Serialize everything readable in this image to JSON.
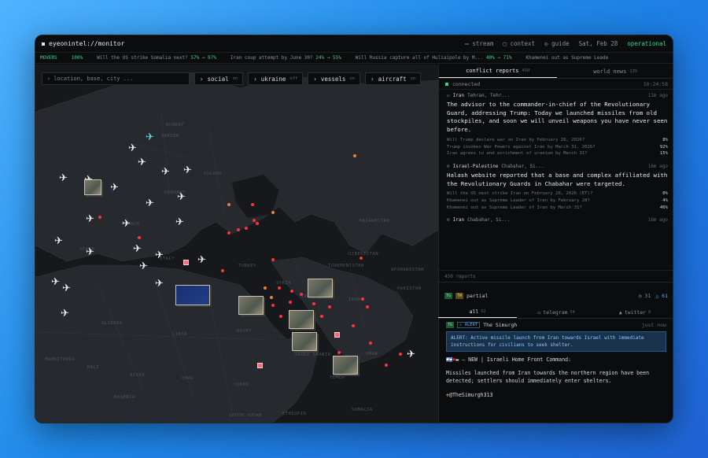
{
  "app": {
    "title": "eyeonintel://monitor"
  },
  "topbar": {
    "stream": "stream",
    "context": "context",
    "guide": "guide",
    "date": "Sat, Feb 28",
    "status": "operational"
  },
  "ticker": {
    "label": "MOVERS",
    "items": [
      {
        "pct": "100%",
        "text": "Will the US strike Somalia next?",
        "move": "57% → 97%"
      },
      {
        "text": "Iran coup attempt by June 30?",
        "move": "24% → 55%"
      },
      {
        "text": "Will Russia capture all of Huliaipole by M...",
        "move": "40% → 71%"
      },
      {
        "text": "Khamenei out as Supreme Leade"
      }
    ]
  },
  "map": {
    "search_placeholder": "location, base, city ...",
    "toggles": [
      {
        "label": "social",
        "state": "on"
      },
      {
        "label": "ukraine",
        "state": "off"
      },
      {
        "label": "vessels",
        "state": "on"
      },
      {
        "label": "aircraft",
        "state": "on"
      }
    ],
    "labels": [
      "NORWAY",
      "SWEDEN",
      "POLAND",
      "KAZAKHSTAN",
      "UZBEKISTAN",
      "TURKMENISTAN",
      "TURKEY",
      "AFGHANISTAN",
      "PAKISTAN",
      "IRAN",
      "IRAQ",
      "SYRIA",
      "ALGERIA",
      "LIBYA",
      "EGYPT",
      "MALI",
      "NIGER",
      "CHAD",
      "SUDAN",
      "SOUTH SUDAN",
      "SAUDI ARABIA",
      "ETHIOPIA",
      "NIGERIA",
      "OMAN",
      "YEMEN",
      "SOMALIA",
      "MAURITANIA",
      "FRANCE",
      "SPAIN",
      "GERMANY",
      "ITALY"
    ]
  },
  "panel": {
    "tabs": [
      {
        "label": "conflict reports",
        "count": "450"
      },
      {
        "label": "world news",
        "count": "135"
      }
    ],
    "connection": {
      "status": "connected",
      "time": "10:24:58"
    },
    "reports": [
      {
        "region": "Iran",
        "location": "Tehran, Tehr...",
        "ago": "11m ago",
        "body": "The advisor to the commander-in-chief of the Revolutionary Guard, addressing Trump: Today we launched missiles from old stockpiles, and soon we will unveil weapons you have never seen before.",
        "markets": [
          {
            "q": "Will Trump declare war on Iran by February 28, 2026?",
            "p": "8%"
          },
          {
            "q": "Trump invokes War Powers against Iran by March 31, 2026?",
            "p": "92%"
          },
          {
            "q": "Iran agrees to end enrichment of uranium by March 31?",
            "p": "15%"
          }
        ]
      },
      {
        "region": "Israel-Palestine",
        "location": "Chabahar, Si...",
        "ago": "16m ago",
        "body": "Halash website reported that a base and complex affiliated with the Revolutionary Guards in Chabahar were targeted.",
        "markets": [
          {
            "q": "Will the US next strike Iran on February 28, 2026 (ET)?",
            "p": "0%"
          },
          {
            "q": "Khamenei out as Supreme Leader of Iran by February 28?",
            "p": "4%"
          },
          {
            "q": "Khamenei out as Supreme Leader of Iran by March 31?",
            "p": "46%"
          }
        ]
      },
      {
        "region": "Iran",
        "location": "Chabahar, Si...",
        "ago": "16m ago"
      }
    ],
    "reports_count": "450 reports",
    "signals": {
      "badge1": "TG",
      "badge2": "TW",
      "status": "partial",
      "count1": "31",
      "count2": "61"
    },
    "feed_tabs": [
      {
        "label": "all",
        "count": "62"
      },
      {
        "label": "telegram",
        "count": "54"
      },
      {
        "label": "twitter",
        "count": "8"
      }
    ],
    "post": {
      "badge": "TG",
      "alert_tag": "ALERT",
      "author": "The Simurgh",
      "ago": "just now",
      "alert": "ALERT: Active missile launch from Iran towards Israel with immediate instructions for civilians to seek shelter.",
      "line1": "— NEW | Israeli Home Front Command:",
      "line2": "Missiles launched from Iran towards the northern region have been detected; settlers should immediately enter shelters.",
      "handle": "@TheSimurgh313"
    }
  },
  "colors": {
    "accent": "#3ecf8e",
    "strike": "#ff3040",
    "event": "#e8843a",
    "alert": "#5aa8ff"
  }
}
